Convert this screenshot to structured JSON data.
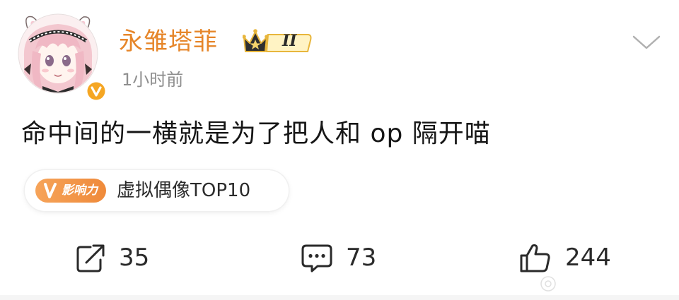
{
  "post": {
    "author": {
      "name": "永雏塔菲",
      "rank_badge": "II",
      "avatar_icon": "anime-avatar-icon",
      "verified_icon": "verified-v-icon",
      "verified_color": "#f5a623"
    },
    "time": "1小时前",
    "text": "命中间的一横就是为了把人和 op 隔开喵",
    "more_icon": "chevron-down-icon",
    "influence_tag": {
      "badge_text": "影响力",
      "badge_letter": "V",
      "label": "虚拟偶像TOP10",
      "badge_color": "#f08c3c"
    },
    "actions": {
      "repost": {
        "icon": "share-icon",
        "count": "35"
      },
      "comment": {
        "icon": "comment-icon",
        "count": "73"
      },
      "like": {
        "icon": "thumbs-up-icon",
        "count": "244"
      }
    },
    "colors": {
      "name": "#e6862a",
      "time": "#8e8e8e",
      "text": "#161616"
    }
  }
}
